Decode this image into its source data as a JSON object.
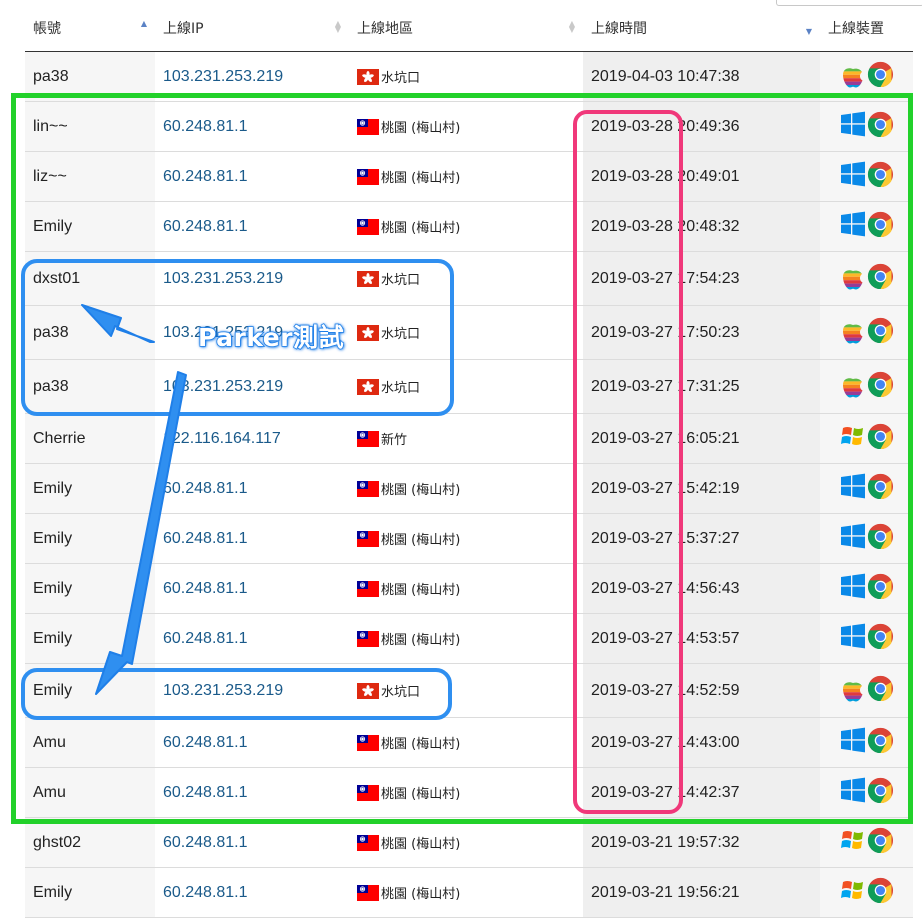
{
  "table": {
    "headers": {
      "account": "帳號",
      "ip": "上線IP",
      "region": "上線地區",
      "time": "上線時間",
      "device": "上線裝置"
    },
    "rows": [
      {
        "account": "pa38",
        "ip": "103.231.253.219",
        "flag": "hk",
        "region": "水坑口",
        "time": "2019-04-03 10:47:38",
        "os": "apple"
      },
      {
        "account": "lin~~",
        "ip": "60.248.81.1",
        "flag": "tw",
        "region": "桃園 (梅山村)",
        "time": "2019-03-28 20:49:36",
        "os": "windows10"
      },
      {
        "account": "liz~~",
        "ip": "60.248.81.1",
        "flag": "tw",
        "region": "桃園 (梅山村)",
        "time": "2019-03-28 20:49:01",
        "os": "windows10"
      },
      {
        "account": "Emily",
        "ip": "60.248.81.1",
        "flag": "tw",
        "region": "桃園 (梅山村)",
        "time": "2019-03-28 20:48:32",
        "os": "windows10"
      },
      {
        "account": "dxst01",
        "ip": "103.231.253.219",
        "flag": "hk",
        "region": "水坑口",
        "time": "2019-03-27 17:54:23",
        "os": "apple"
      },
      {
        "account": "pa38",
        "ip": "103.231.253.219",
        "flag": "hk",
        "region": "水坑口",
        "time": "2019-03-27 17:50:23",
        "os": "apple"
      },
      {
        "account": "pa38",
        "ip": "103.231.253.219",
        "flag": "hk",
        "region": "水坑口",
        "time": "2019-03-27 17:31:25",
        "os": "apple"
      },
      {
        "account": "Cherrie",
        "ip": "122.116.164.117",
        "flag": "tw",
        "region": "新竹",
        "time": "2019-03-27 16:05:21",
        "os": "windows-xp"
      },
      {
        "account": "Emily",
        "ip": "60.248.81.1",
        "flag": "tw",
        "region": "桃園 (梅山村)",
        "time": "2019-03-27 15:42:19",
        "os": "windows10"
      },
      {
        "account": "Emily",
        "ip": "60.248.81.1",
        "flag": "tw",
        "region": "桃園 (梅山村)",
        "time": "2019-03-27 15:37:27",
        "os": "windows10"
      },
      {
        "account": "Emily",
        "ip": "60.248.81.1",
        "flag": "tw",
        "region": "桃園 (梅山村)",
        "time": "2019-03-27 14:56:43",
        "os": "windows10"
      },
      {
        "account": "Emily",
        "ip": "60.248.81.1",
        "flag": "tw",
        "region": "桃園 (梅山村)",
        "time": "2019-03-27 14:53:57",
        "os": "windows10"
      },
      {
        "account": "Emily",
        "ip": "103.231.253.219",
        "flag": "hk",
        "region": "水坑口",
        "time": "2019-03-27 14:52:59",
        "os": "apple"
      },
      {
        "account": "Amu",
        "ip": "60.248.81.1",
        "flag": "tw",
        "region": "桃園 (梅山村)",
        "time": "2019-03-27 14:43:00",
        "os": "windows10"
      },
      {
        "account": "Amu",
        "ip": "60.248.81.1",
        "flag": "tw",
        "region": "桃園 (梅山村)",
        "time": "2019-03-27 14:42:37",
        "os": "windows10"
      },
      {
        "account": "ghst02",
        "ip": "60.248.81.1",
        "flag": "tw",
        "region": "桃園 (梅山村)",
        "time": "2019-03-21 19:57:32",
        "os": "windows-xp"
      },
      {
        "account": "Emily",
        "ip": "60.248.81.1",
        "flag": "tw",
        "region": "桃園 (梅山村)",
        "time": "2019-03-21 19:56:21",
        "os": "windows-xp"
      }
    ]
  },
  "annotation": {
    "label": "Parker測試",
    "colors": {
      "green": "#22d12a",
      "pink": "#f0387a",
      "blue": "#2f8ff0"
    }
  },
  "icons": {
    "sort": "sort-arrows-icon",
    "browser": "chrome-icon",
    "hk_flag": "hong-kong-flag-icon",
    "tw_flag": "taiwan-flag-icon"
  }
}
